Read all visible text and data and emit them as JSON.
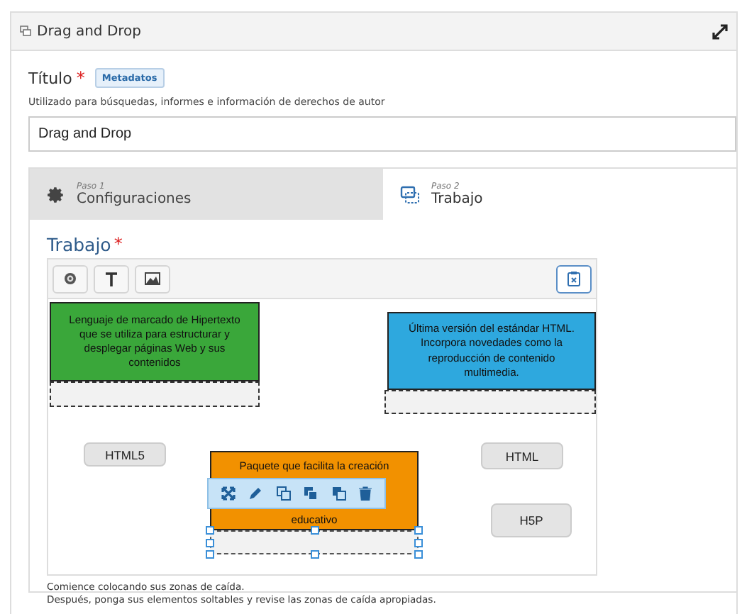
{
  "panel": {
    "title": "Drag and Drop"
  },
  "title_field": {
    "label": "Título",
    "required_mark": "*",
    "tag": "Metadatos",
    "description": "Utilizado para búsquedas, informes e información de derechos de autor",
    "value": "Drag and Drop"
  },
  "steps": [
    {
      "step": "Paso 1",
      "label": "Configuraciones",
      "selected": false
    },
    {
      "step": "Paso 2",
      "label": "Trabajo",
      "selected": true
    }
  ],
  "work": {
    "heading": "Trabajo",
    "required_mark": "*"
  },
  "canvas_items": [
    {
      "kind": "text",
      "lines": [
        "Lenguaje de marcado de Hipertexto que se utiliza para estructurar y desplegar páginas Web y sus contenidos"
      ],
      "color": "#3aa73a"
    },
    {
      "kind": "dropzone",
      "selected": false
    },
    {
      "kind": "text",
      "lines": [
        "Última versión del estándar HTML. Incorpora novedades como la reproducción de contenido multimedia."
      ],
      "color": "#2ea8de"
    },
    {
      "kind": "dropzone",
      "selected": false
    },
    {
      "kind": "label",
      "text": "HTML5"
    },
    {
      "kind": "label",
      "text": "HTML"
    },
    {
      "kind": "text",
      "lines": [
        "Paquete que facilita la creación",
        "educativo"
      ],
      "color": "#f29100"
    },
    {
      "kind": "dropzone",
      "selected": true
    },
    {
      "kind": "label",
      "text": "H5P"
    }
  ],
  "instructions": [
    "Comience colocando sus zonas de caída.",
    "Después, ponga sus elementos soltables y revise las zonas de caída apropiadas."
  ]
}
